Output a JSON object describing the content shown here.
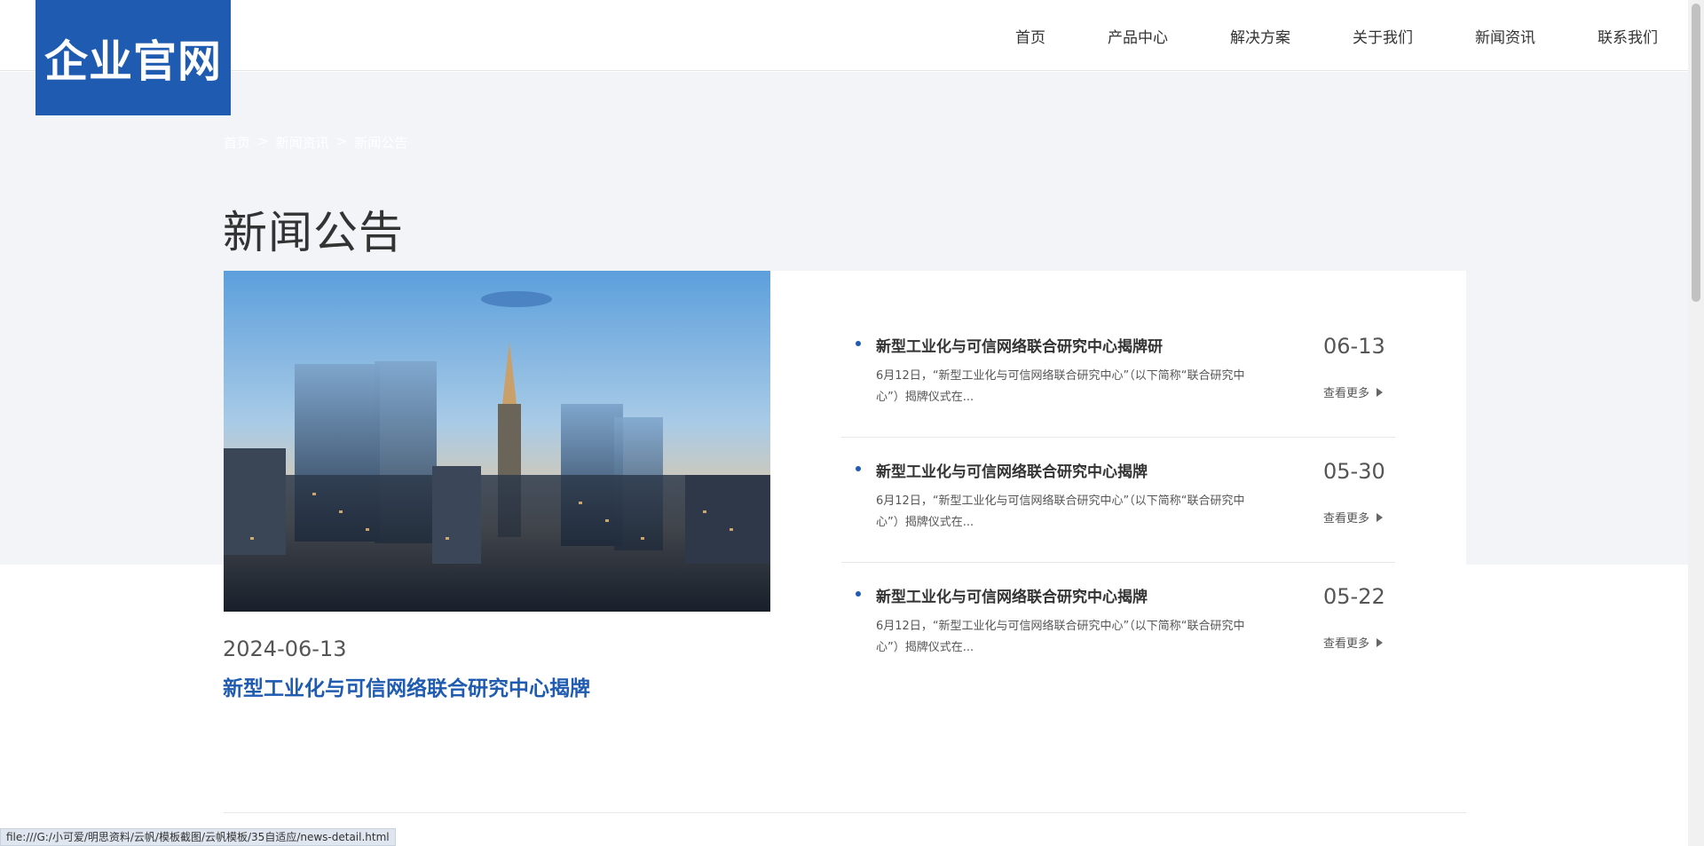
{
  "logo": {
    "text": "企业官网"
  },
  "nav": {
    "items": [
      "首页",
      "产品中心",
      "解决方案",
      "关于我们",
      "新闻资讯",
      "联系我们"
    ]
  },
  "breadcrumb": {
    "home": "首页",
    "sep1": ">",
    "news": "新闻资讯",
    "sep2": ">",
    "current": "新闻公告"
  },
  "page_title": "新闻公告",
  "feature": {
    "date": "2024-06-13",
    "title": "新型工业化与可信网络联合研究中心揭牌"
  },
  "news": [
    {
      "title": "新型工业化与可信网络联合研究中心揭牌研",
      "summary": "6月12日，“新型工业化与可信网络联合研究中心”（以下简称“联合研究中心”）揭牌仪式在...",
      "date": "06-13",
      "more": "查看更多"
    },
    {
      "title": "新型工业化与可信网络联合研究中心揭牌",
      "summary": "6月12日，“新型工业化与可信网络联合研究中心”（以下简称“联合研究中心”）揭牌仪式在...",
      "date": "05-30",
      "more": "查看更多"
    },
    {
      "title": "新型工业化与可信网络联合研究中心揭牌",
      "summary": "6月12日，“新型工业化与可信网络联合研究中心”（以下简称“联合研究中心”）揭牌仪式在...",
      "date": "05-22",
      "more": "查看更多"
    }
  ],
  "status_bar": {
    "url": "file:///G:/小可爱/明思资料/云帆/模板截图/云帆模板/35自适应/news-detail.html"
  },
  "colors": {
    "brand": "#1f5bb0",
    "band": "#f3f4f8"
  }
}
